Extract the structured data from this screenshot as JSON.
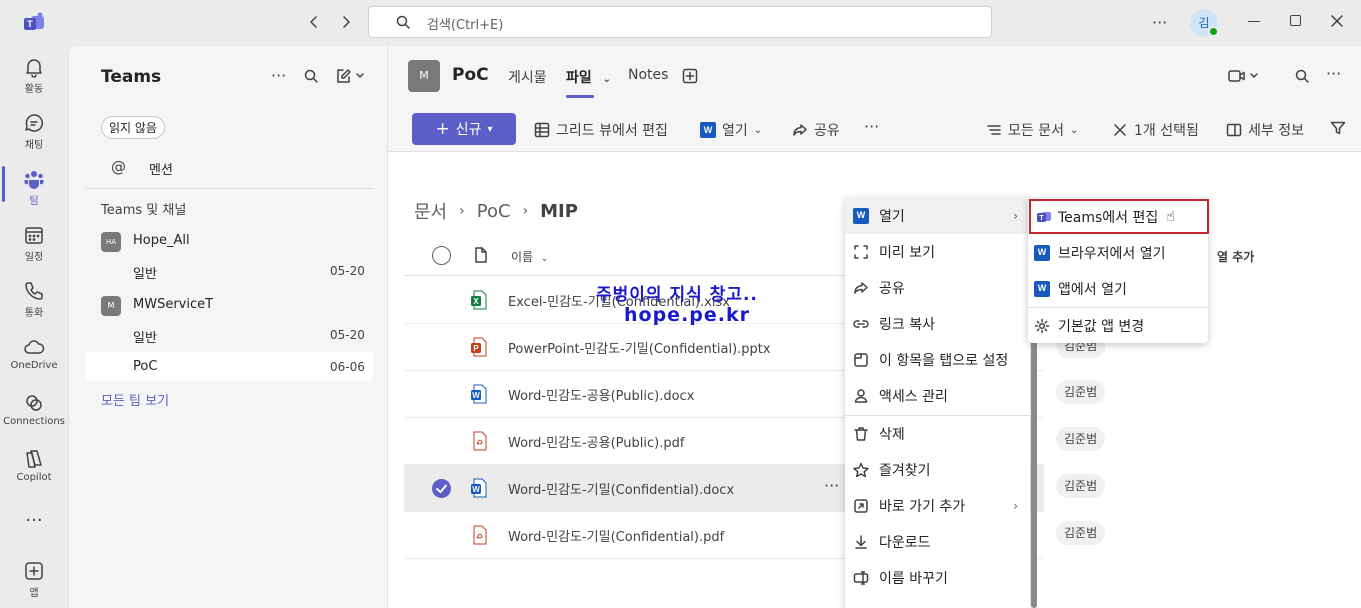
{
  "titlebar": {
    "search_placeholder": "검색(Ctrl+E)",
    "avatar_initial": "김"
  },
  "rail": [
    {
      "label": "활동",
      "icon": "bell-icon"
    },
    {
      "label": "채팅",
      "icon": "chat-icon"
    },
    {
      "label": "팀",
      "icon": "teams-icon"
    },
    {
      "label": "일정",
      "icon": "calendar-icon"
    },
    {
      "label": "통화",
      "icon": "phone-icon"
    },
    {
      "label": "OneDrive",
      "icon": "cloud-icon"
    },
    {
      "label": "Connections",
      "icon": "connections-icon"
    },
    {
      "label": "Copilot",
      "icon": "copilot-icon"
    },
    {
      "label": "앱",
      "icon": "add-app-icon"
    }
  ],
  "leftpanel": {
    "title": "Teams",
    "filter_chip": "읽지 않음",
    "mentions": "멘션",
    "section_label": "Teams 및 채널",
    "teams": [
      {
        "initials": "HA",
        "name": "Hope_All",
        "channels": [
          {
            "name": "일반",
            "date": "05-20"
          }
        ]
      },
      {
        "initials": "M",
        "name": "MWServiceT",
        "channels": [
          {
            "name": "일반",
            "date": "05-20"
          },
          {
            "name": "PoC",
            "date": "06-06"
          }
        ]
      }
    ],
    "see_all": "모든 팀 보기"
  },
  "header": {
    "team_initial": "M",
    "channel": "PoC",
    "tabs": [
      "게시물",
      "파일",
      "Notes"
    ],
    "active_tab": "파일"
  },
  "toolbar": {
    "new_label": "신규",
    "grid_edit": "그리드 뷰에서 편집",
    "open": "열기",
    "share": "공유",
    "all_docs": "모든 문서",
    "selected": "1개 선택됨",
    "details": "세부 정보"
  },
  "breadcrumb": [
    "문서",
    "PoC",
    "MIP"
  ],
  "table": {
    "col_name": "이름",
    "col_add": "열 추가",
    "rows": [
      {
        "name": "Excel-민감도-기밀(Confidential).xlsx",
        "type": "excel",
        "modified_by": "",
        "selected": false
      },
      {
        "name": "PowerPoint-민감도-기밀(Confidential).pptx",
        "type": "ppt",
        "modified_by": "김준범",
        "selected": false
      },
      {
        "name": "Word-민감도-공용(Public).docx",
        "type": "word",
        "modified_by": "김준범",
        "selected": false
      },
      {
        "name": "Word-민감도-공용(Public).pdf",
        "type": "pdf",
        "modified_by": "김준범",
        "selected": false
      },
      {
        "name": "Word-민감도-기밀(Confidential).docx",
        "type": "word",
        "modified_by": "김준범",
        "selected": true
      },
      {
        "name": "Word-민감도-기밀(Confidential).pdf",
        "type": "pdf",
        "modified_by": "김준범",
        "selected": false
      }
    ]
  },
  "watermark": {
    "line1": "주벙이의 지식 창고..",
    "line2": "hope.pe.kr"
  },
  "context_menu": [
    {
      "label": "열기",
      "icon": "word-icon",
      "submenu": true
    },
    {
      "label": "미리 보기",
      "icon": "preview-icon"
    },
    {
      "label": "공유",
      "icon": "share-icon"
    },
    {
      "label": "링크 복사",
      "icon": "link-icon"
    },
    {
      "label": "이 항목을 탭으로 설정",
      "icon": "tab-icon"
    },
    {
      "label": "액세스 관리",
      "icon": "person-icon"
    },
    {
      "label": "삭제",
      "icon": "trash-icon"
    },
    {
      "label": "즐겨찾기",
      "icon": "star-icon"
    },
    {
      "label": "바로 가기 추가",
      "icon": "shortcut-icon",
      "submenu": true
    },
    {
      "label": "다운로드",
      "icon": "download-icon"
    },
    {
      "label": "이름 바꾸기",
      "icon": "rename-icon"
    }
  ],
  "submenu": [
    {
      "label": "Teams에서 편집",
      "icon": "teams-edit-icon"
    },
    {
      "label": "브라우저에서 열기",
      "icon": "word-icon"
    },
    {
      "label": "앱에서 열기",
      "icon": "word-icon"
    },
    {
      "label": "기본값 앱 변경",
      "icon": "gear-icon"
    }
  ],
  "colors": {
    "accent": "#5b5fc7",
    "highlight_border": "#c4262e",
    "word": "#185abd",
    "excel": "#107c41",
    "ppt": "#c43e1c"
  }
}
